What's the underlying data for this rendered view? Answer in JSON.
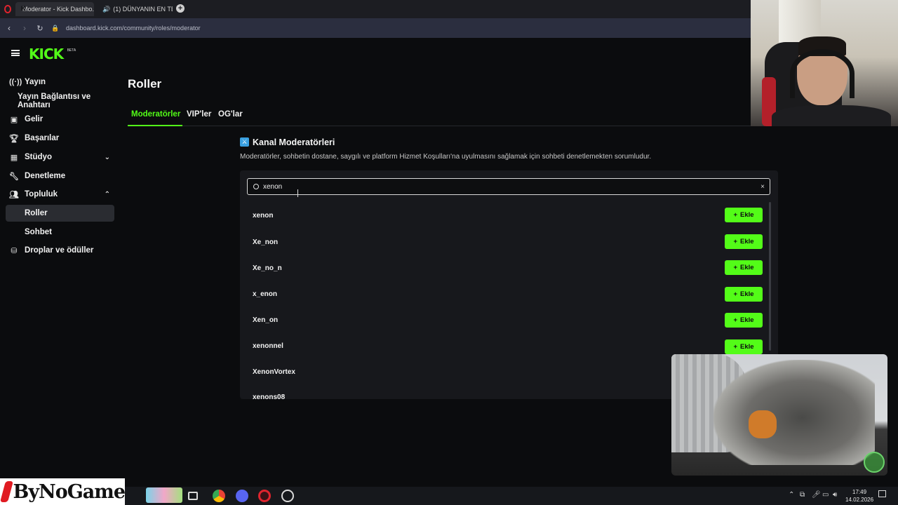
{
  "browser": {
    "tabs": [
      {
        "label": "Moderator - Kick Dashbo..."
      },
      {
        "label": "(1) DÜNYANIN EN TE..."
      }
    ],
    "url": "dashboard.kick.com/community/roles/moderator",
    "url_host_bold": "kick.com"
  },
  "brand": {
    "logo_text": "KICK",
    "beta": "BETA"
  },
  "sidebar": {
    "items": [
      {
        "label": "Yayın",
        "icon": "broadcast-icon"
      },
      {
        "label": "Yayın Bağlantısı ve Anahtarı",
        "icon": ""
      },
      {
        "label": "Gelir",
        "icon": "money-icon"
      },
      {
        "label": "Başarılar",
        "icon": "trophy-icon"
      },
      {
        "label": "Stüdyo",
        "icon": "studio-icon"
      },
      {
        "label": "Denetleme",
        "icon": "wrench-icon"
      },
      {
        "label": "Topluluk",
        "icon": "community-icon"
      },
      {
        "label": "Roller",
        "icon": ""
      },
      {
        "label": "Sohbet",
        "icon": ""
      },
      {
        "label": "Droplar ve ödüller",
        "icon": "drops-icon"
      }
    ]
  },
  "main": {
    "title": "Roller",
    "tabs": [
      {
        "label": "Moderatörler"
      },
      {
        "label": "VIP'ler"
      },
      {
        "label": "OG'lar"
      }
    ],
    "section_title": "Kanal Moderatörleri",
    "section_desc": "Moderatörler, sohbetin dostane, saygılı ve platform Hizmet Koşulları'na uyulmasını sağlamak için sohbeti denetlemekten sorumludur.",
    "search": {
      "value": "xenon",
      "clear": "×"
    },
    "add_label": "Ekle",
    "results": [
      {
        "name": "xenon"
      },
      {
        "name": "Xe_non"
      },
      {
        "name": "Xe_no_n"
      },
      {
        "name": "x_enon"
      },
      {
        "name": "Xen_on"
      },
      {
        "name": "xenonnel"
      },
      {
        "name": "XenonVortex"
      },
      {
        "name": "xenons08"
      }
    ]
  },
  "taskbar": {
    "brand_text": "ByNoGame",
    "time": "17:49",
    "date": "14.02.2026"
  },
  "colors": {
    "accent": "#53fc18",
    "background": "#0b0c0e",
    "panel": "#17181c",
    "address_bar": "#2b2e3f"
  }
}
